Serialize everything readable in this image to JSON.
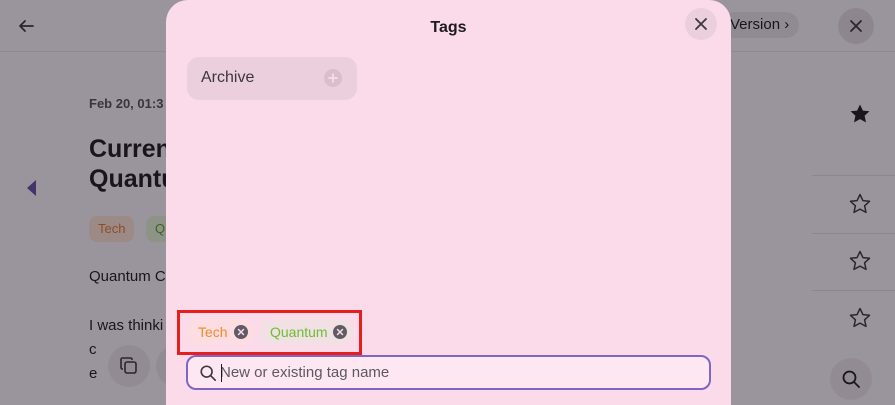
{
  "background": {
    "version_label": "Version ›",
    "date": "Feb 20, 01:3",
    "title_lines": [
      "Curren",
      "Quantu"
    ],
    "tags": [
      "Tech",
      "Q"
    ],
    "body_lines": [
      "Quantum C",
      "I was thinki",
      "c",
      "e"
    ]
  },
  "dialog": {
    "title": "Tags",
    "available_tags": [
      {
        "label": "Archive"
      }
    ],
    "selected_tags": [
      {
        "label": "Tech",
        "color": "#ef8a2d"
      },
      {
        "label": "Quantum",
        "color": "#6bbf2e"
      }
    ],
    "input": {
      "placeholder": "New or existing tag name",
      "value": ""
    }
  },
  "colors": {
    "dialog_bg": "#fbdbe9",
    "accent": "#7e65c6",
    "highlight_box": "#e61e1e"
  },
  "icons": [
    "back-arrow-icon",
    "close-icon",
    "star-filled-icon",
    "star-outline-icon",
    "copy-icon",
    "search-icon",
    "plus-icon",
    "remove-icon"
  ]
}
